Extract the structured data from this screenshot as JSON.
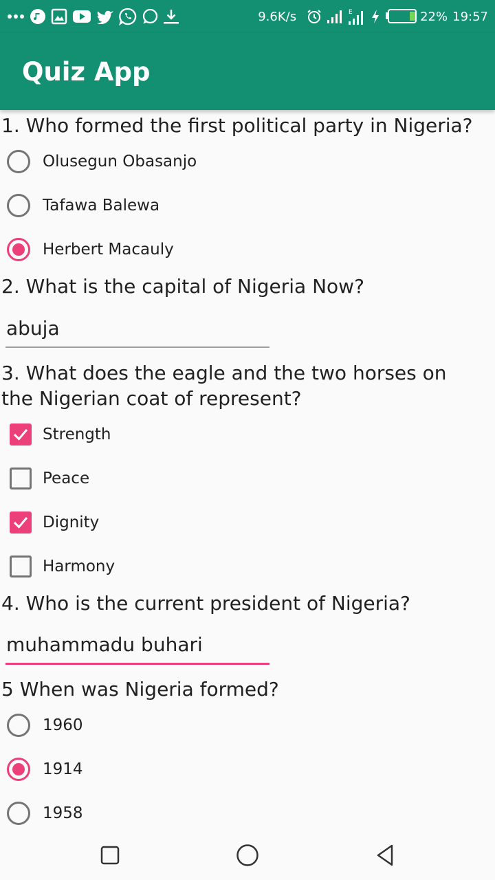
{
  "status_bar": {
    "network_speed": "9.6K/s",
    "battery_percent": "22%",
    "time": "19:57",
    "icons": [
      "more-icon",
      "music-icon",
      "image-icon",
      "youtube-icon",
      "twitter-icon",
      "whatsapp-icon",
      "chat-icon",
      "download-icon",
      "alarm-icon",
      "signal-icon",
      "signal-e-icon",
      "charging-icon",
      "battery-icon"
    ],
    "battery_level": 0.22
  },
  "app_bar": {
    "title": "Quiz App"
  },
  "questions": [
    {
      "text": "1. Who formed the first political party in Nigeria?",
      "options": [
        {
          "label": "Olusegun Obasanjo",
          "checked": false
        },
        {
          "label": "Tafawa Balewa",
          "checked": false
        },
        {
          "label": "Herbert Macauly",
          "checked": true
        }
      ]
    },
    {
      "text": "2. What is the capital of Nigeria Now?",
      "answer": "abuja"
    },
    {
      "text": "3. What does the eagle and the two horses on the Nigerian coat of represent?",
      "options": [
        {
          "label": "Strength",
          "checked": true
        },
        {
          "label": "Peace",
          "checked": false
        },
        {
          "label": "Dignity",
          "checked": true
        },
        {
          "label": "Harmony",
          "checked": false
        }
      ]
    },
    {
      "text": "4. Who is the current president of Nigeria?",
      "answer": "muhammadu buhari"
    },
    {
      "text": "5 When was Nigeria formed?",
      "options": [
        {
          "label": "1960",
          "checked": false
        },
        {
          "label": "1914",
          "checked": true
        },
        {
          "label": "1958",
          "checked": false
        }
      ]
    }
  ],
  "nav_bar": {
    "buttons": [
      "recents-icon",
      "home-icon",
      "back-icon"
    ]
  },
  "colors": {
    "primary": "#138f72",
    "accent": "#ec407a"
  }
}
